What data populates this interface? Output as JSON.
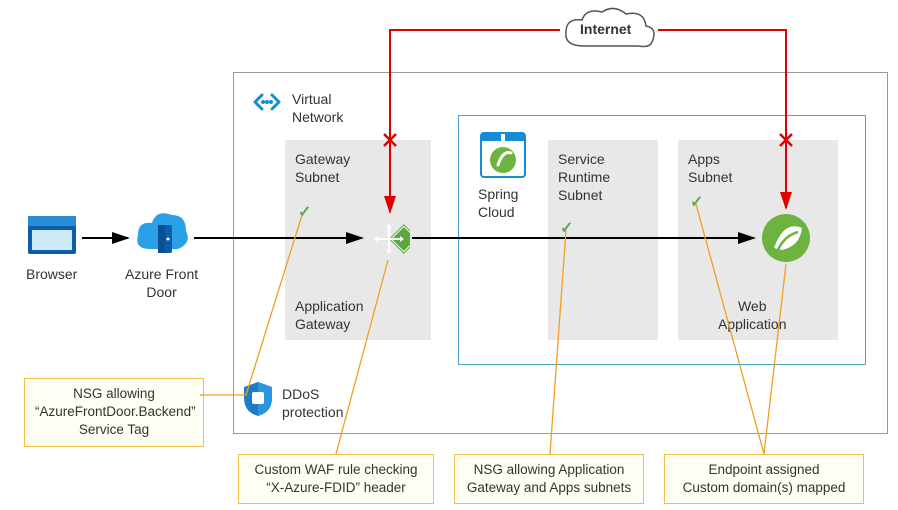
{
  "internet": {
    "label": "Internet"
  },
  "browser": {
    "label": "Browser"
  },
  "front_door": {
    "label": "Azure Front\nDoor"
  },
  "vnet": {
    "label": "Virtual\nNetwork"
  },
  "gateway_subnet": {
    "title": "Gateway\nSubnet",
    "caption": "Application\nGateway"
  },
  "spring_cloud": {
    "label": "Spring\nCloud"
  },
  "runtime_subnet": {
    "title": "Service\nRuntime\nSubnet"
  },
  "apps_subnet": {
    "title": "Apps\nSubnet",
    "caption": "Web\nApplication"
  },
  "ddos": {
    "label": "DDoS\nprotection"
  },
  "callouts": {
    "nsg_afd": "NSG allowing\n“AzureFrontDoor.Backend”\nService Tag",
    "waf": "Custom WAF rule checking\n“X-Azure-FDID” header",
    "nsg_sc": "NSG allowing Application\nGateway and Apps subnets",
    "endpoint": "Endpoint assigned\nCustom domain(s) mapped"
  }
}
